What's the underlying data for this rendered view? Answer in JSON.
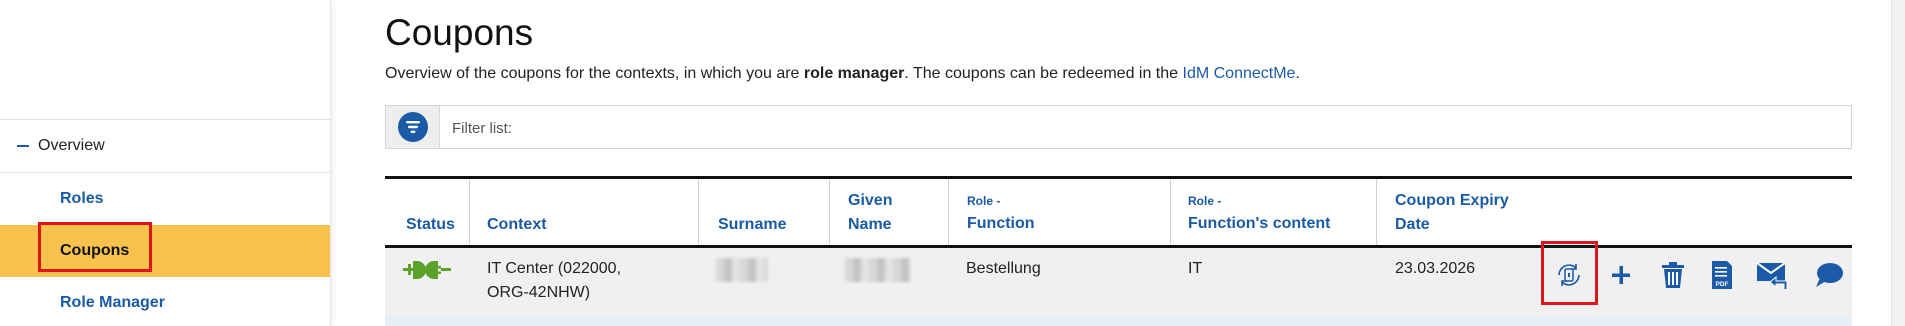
{
  "sidebar": {
    "overview": "Overview",
    "roles": "Roles",
    "coupons": "Coupons",
    "role_manager": "Role Manager"
  },
  "page": {
    "title": "Coupons",
    "desc_prefix": "Overview of the coupons for the contexts, in which you are ",
    "desc_bold": "role manager",
    "desc_middle": ". The coupons can be redeemed in the ",
    "desc_link": "IdM ConnectMe",
    "desc_suffix": "."
  },
  "filter": {
    "placeholder": "Filter list:",
    "icon": "filter-icon"
  },
  "table": {
    "headers": {
      "status": "Status",
      "context": "Context",
      "surname": "Surname",
      "given_1": "Given",
      "given_2": "Name",
      "role_fn_small": "Role -",
      "role_fn": "Function",
      "role_fc_small": "Role -",
      "role_fc": "Function's content",
      "expiry_1": "Coupon Expiry",
      "expiry_2": "Date"
    },
    "rows": [
      {
        "status_icon": "plug-connected-icon",
        "context_1": "IT Center (022000,",
        "context_2": "ORG-42NHW)",
        "function": "Bestellung",
        "function_content": "IT",
        "expiry": "23.03.2026"
      }
    ],
    "actions": [
      "renew-coupon-icon",
      "add-icon",
      "trash-icon",
      "pdf-icon",
      "mail-forward-icon",
      "comment-icon"
    ]
  },
  "colors": {
    "link": "#1a5aa6",
    "active": "#f9c24d",
    "highlight": "#e0141b",
    "status_green": "#5aa22a"
  }
}
